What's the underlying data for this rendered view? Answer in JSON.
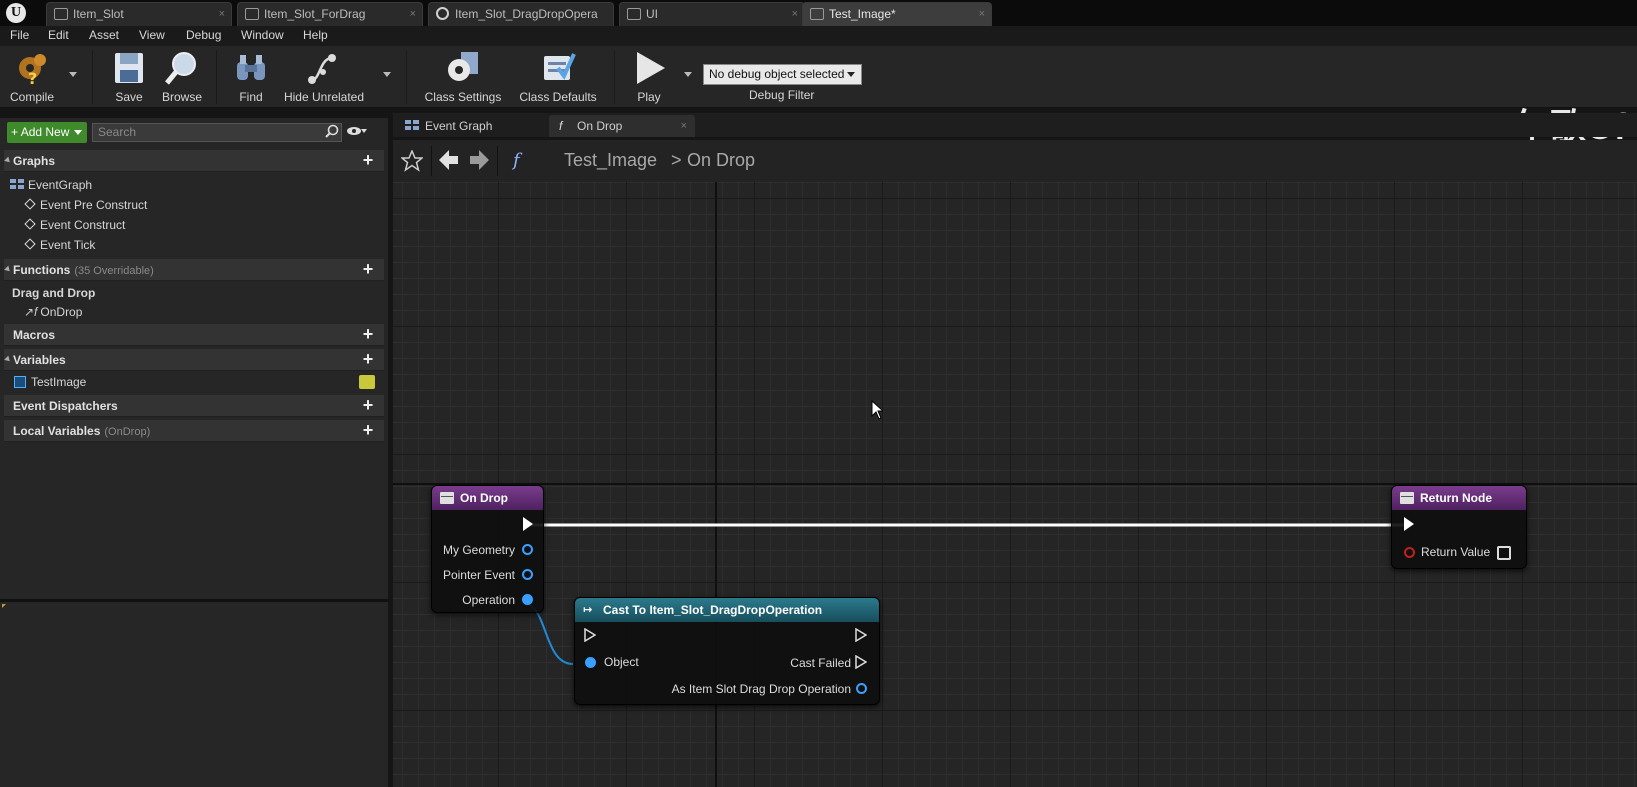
{
  "tabs": [
    {
      "label": "Item_Slot"
    },
    {
      "label": "Item_Slot_ForDrag"
    },
    {
      "label": "Item_Slot_DragDropOpera"
    },
    {
      "label": "UI"
    },
    {
      "label": "Test_Image*"
    }
  ],
  "menu": [
    "File",
    "Edit",
    "Asset",
    "View",
    "Debug",
    "Window",
    "Help"
  ],
  "toolbar": {
    "compile": "Compile",
    "save": "Save",
    "browse": "Browse",
    "find": "Find",
    "hide_unrelated": "Hide Unrelated",
    "class_settings": "Class Settings",
    "class_defaults": "Class Defaults",
    "play": "Play",
    "debug_object": "No debug object selected",
    "debug_filter": "Debug Filter"
  },
  "watermark": "午歌Of",
  "left": {
    "add_new": "Add New",
    "search_placeholder": "Search",
    "graphs": "Graphs",
    "event_graph": "EventGraph",
    "event_pre_construct": "Event Pre Construct",
    "event_construct": "Event Construct",
    "event_tick": "Event Tick",
    "functions": "Functions",
    "functions_sub": "(35 Overridable)",
    "drag_and_drop": "Drag and Drop",
    "on_drop": "OnDrop",
    "macros": "Macros",
    "variables": "Variables",
    "test_image": "TestImage",
    "event_dispatchers": "Event Dispatchers",
    "local_variables": "Local Variables",
    "local_variables_sub": "(OnDrop)"
  },
  "graph_tabs": {
    "event_graph": "Event Graph",
    "on_drop": "On Drop"
  },
  "breadcrumb": {
    "blueprint": "Test_Image",
    "function": "On Drop",
    "separator": ">",
    "fn_glyph": "f"
  },
  "nodes": {
    "on_drop": {
      "title": "On Drop",
      "pins": [
        "My Geometry",
        "Pointer Event",
        "Operation"
      ]
    },
    "return_node": {
      "title": "Return Node",
      "return_value": "Return Value"
    },
    "cast": {
      "title": "Cast To Item_Slot_DragDropOperation",
      "object": "Object",
      "cast_failed": "Cast Failed",
      "as_output": "As Item Slot Drag Drop Operation"
    }
  },
  "colors": {
    "exec_wire": "#ffffff",
    "object_pin": "#3aa0ff",
    "function_header": "#7a3c8c",
    "cast_header": "#2b7a8c",
    "add_new": "#3f8a2b"
  }
}
